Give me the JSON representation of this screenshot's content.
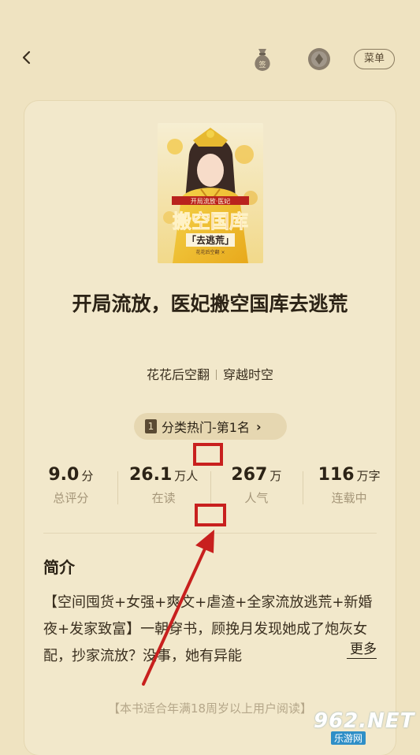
{
  "header": {
    "back_icon": "chevron-left-icon",
    "bag_icon": "money-bag-icon",
    "bag_label": "签",
    "coin_icon": "coin-icon",
    "menu_label": "菜单"
  },
  "book": {
    "title": "开局流放，医妃搬空国库去逃荒",
    "author": "花花后空翻",
    "category": "穿越时空",
    "cover_texts": {
      "top": "开局流放·医妃",
      "main": "搬空国库",
      "sub": "「去逃荒」",
      "author": "花花后空翻 ×"
    }
  },
  "rank": {
    "badge": "1",
    "label": "分类热门-第1名"
  },
  "stats": [
    {
      "value": "9.0",
      "unit": "分",
      "label": "总评分"
    },
    {
      "value": "26.1",
      "unit": "万人",
      "label": "在读"
    },
    {
      "value": "267",
      "unit": "万",
      "label": "人气"
    },
    {
      "value": "116",
      "unit": "万字",
      "label": "连载中"
    }
  ],
  "intro": {
    "heading": "简介",
    "text": "【空间囤货+女强+爽文+虐渣+全家流放逃荒+新婚夜+发家致富】一朝穿书，顾挽月发现她成了炮灰女配，抄家流放？没事，她有异能",
    "more": "更多"
  },
  "notice": "【本书适合年满18周岁以上用户阅读】",
  "watermark": {
    "top": "962.NET",
    "bottom": "乐游网"
  },
  "colors": {
    "background": "#efe3c1",
    "card": "#f2e8cb",
    "highlight": "#c8201e"
  }
}
